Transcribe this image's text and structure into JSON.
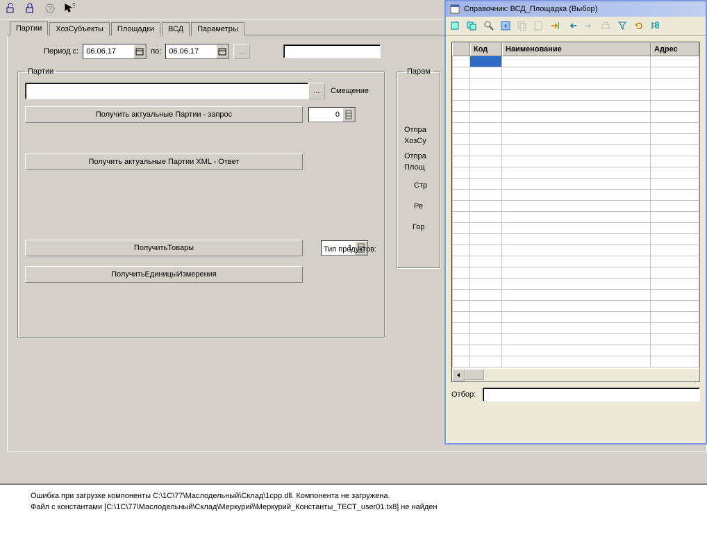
{
  "toolbar": {
    "icons": [
      "lock1",
      "lock2",
      "help",
      "pointer"
    ]
  },
  "tabs": [
    "Партии",
    "ХозСубъекты",
    "Площадки",
    "ВСД",
    "Параметры"
  ],
  "active_tab": 0,
  "period": {
    "label_from": "Период с:",
    "date_from": "06.06.17",
    "label_to": "по:",
    "date_to": "06.06.17"
  },
  "fieldset_parties": {
    "legend": "Партии",
    "input_value": "",
    "btn_request": "Получить актуальные Партии - запрос",
    "btn_xml_response": "Получить актуальные Партии XML - Ответ",
    "btn_get_goods": "ПолучитьТовары",
    "btn_get_units": "ПолучитьЕдиницыИзмерения",
    "offset_label": "Смещение",
    "offset_value": "0",
    "product_type_label": "Тип продуктов:",
    "product_type_value": "1"
  },
  "fieldset_params": {
    "legend": "Парам",
    "labels": [
      "Отпра",
      "ХозСу",
      "Отпра",
      "Площ",
      "Стр",
      "Ре",
      "Гор"
    ]
  },
  "ref_window": {
    "title": "Справочник: ВСД_Площадка (Выбор)",
    "columns": [
      "",
      "Код",
      "Наименование",
      "Адрес"
    ],
    "filter_label": "Отбор:"
  },
  "messages": [
    "Ошибка при загрузке компоненты C:\\1C\\77\\Маслодельный\\Склад\\1cpp.dll. Компонента не загружена.",
    "Файл с константами [C:\\1C\\77\\Маслодельный\\Склад\\Меркурий\\Меркурий_Константы_ТЕСТ_user01.tx8] не найден"
  ]
}
